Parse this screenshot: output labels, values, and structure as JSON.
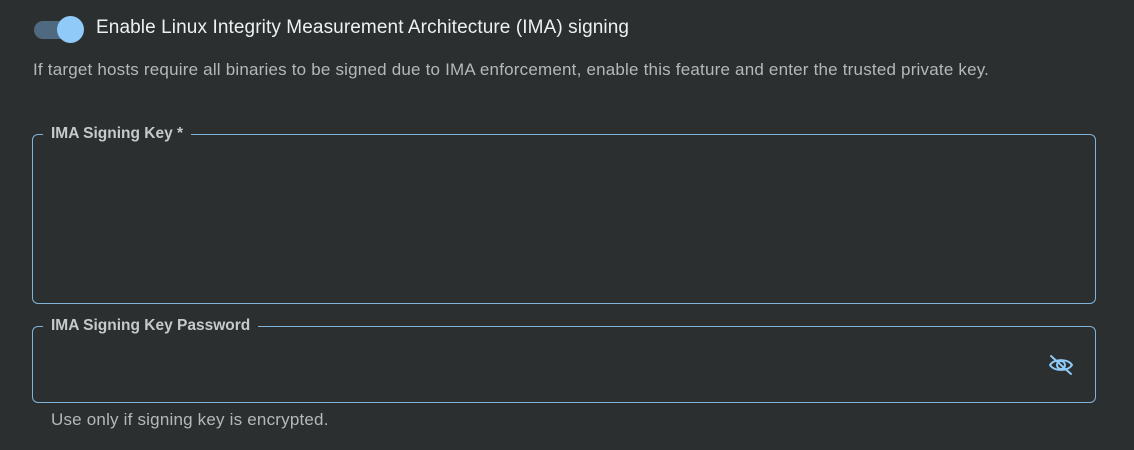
{
  "ima": {
    "toggle": {
      "label": "Enable Linux Integrity Measurement Architecture (IMA) signing",
      "checked": true
    },
    "helper_text": "If target hosts require all binaries to be signed due to IMA enforcement, enable this feature and enter the trusted private key.",
    "signing_key": {
      "label": "IMA Signing Key *",
      "value": ""
    },
    "password": {
      "label": "IMA Signing Key Password",
      "value": "",
      "hint": "Use only if signing key is encrypted.",
      "visibility_icon": "eye-off-icon"
    }
  },
  "colors": {
    "background": "#2b2f2f",
    "accent": "#90caf9",
    "track": "#4f6a80",
    "outline": "#7fb3da"
  }
}
